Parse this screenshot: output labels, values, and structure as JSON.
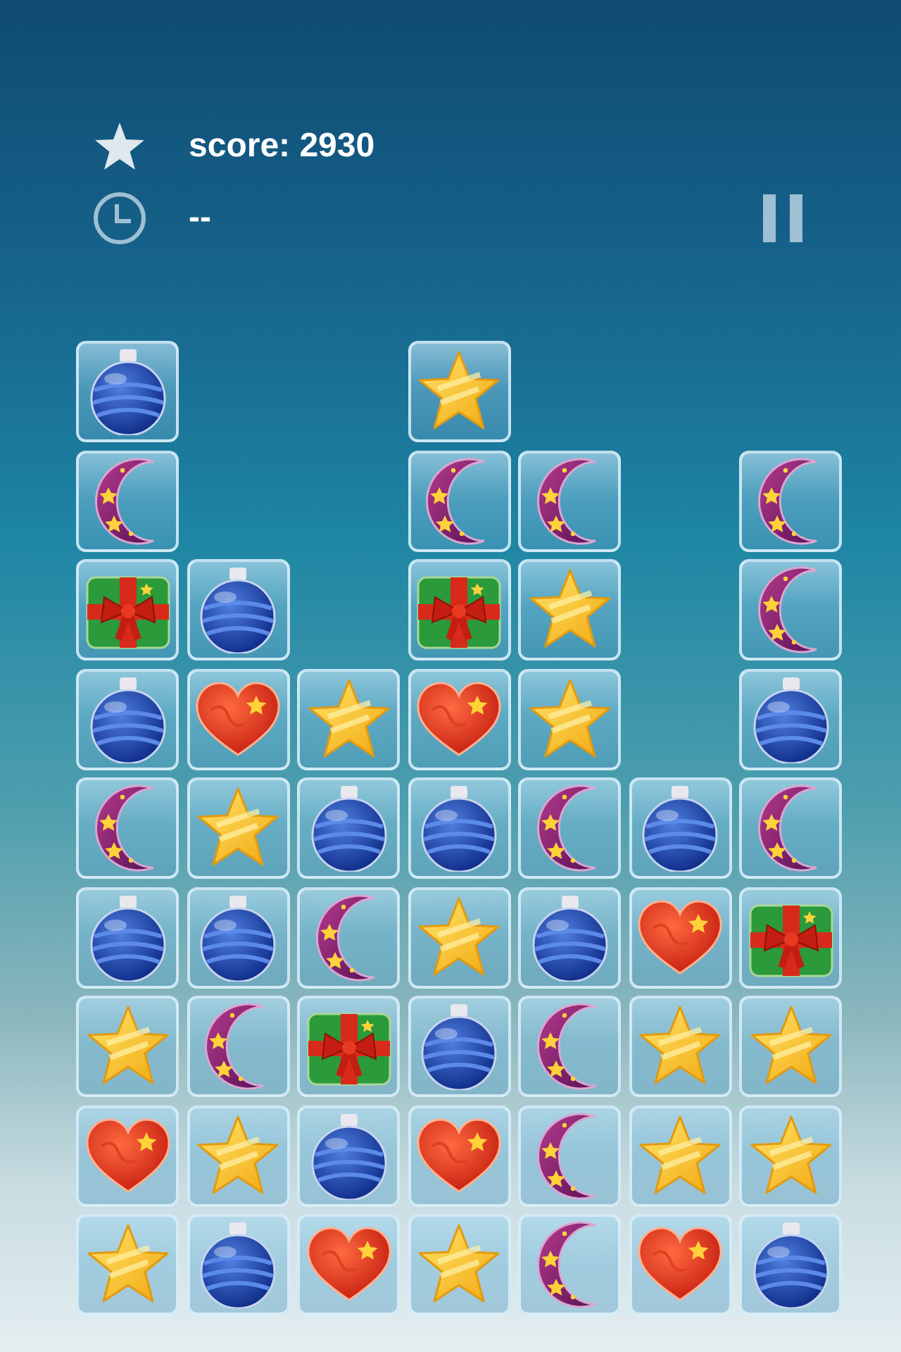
{
  "hud": {
    "score": "score: 2930",
    "timer": "--"
  },
  "board": {
    "rows": [
      {
        "cells": [
          {
            "kind": "ornament"
          },
          {
            "kind": "empty"
          },
          {
            "kind": "empty"
          },
          {
            "kind": "star"
          },
          {
            "kind": "empty"
          },
          {
            "kind": "empty"
          },
          {
            "kind": "empty"
          }
        ]
      },
      {
        "cells": [
          {
            "kind": "moon"
          },
          {
            "kind": "empty"
          },
          {
            "kind": "empty"
          },
          {
            "kind": "moon"
          },
          {
            "kind": "moon"
          },
          {
            "kind": "empty"
          },
          {
            "kind": "moon"
          }
        ]
      },
      {
        "cells": [
          {
            "kind": "gift"
          },
          {
            "kind": "ornament"
          },
          {
            "kind": "empty"
          },
          {
            "kind": "gift"
          },
          {
            "kind": "star"
          },
          {
            "kind": "empty"
          },
          {
            "kind": "moon"
          }
        ]
      },
      {
        "cells": [
          {
            "kind": "ornament"
          },
          {
            "kind": "heart"
          },
          {
            "kind": "star"
          },
          {
            "kind": "heart"
          },
          {
            "kind": "star"
          },
          {
            "kind": "empty"
          },
          {
            "kind": "ornament"
          }
        ]
      },
      {
        "cells": [
          {
            "kind": "moon"
          },
          {
            "kind": "star"
          },
          {
            "kind": "ornament"
          },
          {
            "kind": "ornament"
          },
          {
            "kind": "moon"
          },
          {
            "kind": "ornament"
          },
          {
            "kind": "moon"
          }
        ]
      },
      {
        "cells": [
          {
            "kind": "ornament"
          },
          {
            "kind": "ornament"
          },
          {
            "kind": "moon"
          },
          {
            "kind": "star"
          },
          {
            "kind": "ornament"
          },
          {
            "kind": "heart"
          },
          {
            "kind": "gift"
          }
        ]
      },
      {
        "cells": [
          {
            "kind": "star"
          },
          {
            "kind": "moon"
          },
          {
            "kind": "gift"
          },
          {
            "kind": "ornament"
          },
          {
            "kind": "moon"
          },
          {
            "kind": "star"
          },
          {
            "kind": "star"
          }
        ]
      },
      {
        "cells": [
          {
            "kind": "heart"
          },
          {
            "kind": "star"
          },
          {
            "kind": "ornament"
          },
          {
            "kind": "heart"
          },
          {
            "kind": "moon"
          },
          {
            "kind": "star"
          },
          {
            "kind": "star"
          }
        ]
      },
      {
        "cells": [
          {
            "kind": "star"
          },
          {
            "kind": "ornament"
          },
          {
            "kind": "heart"
          },
          {
            "kind": "star"
          },
          {
            "kind": "moon"
          },
          {
            "kind": "heart"
          },
          {
            "kind": "ornament"
          }
        ]
      }
    ]
  }
}
